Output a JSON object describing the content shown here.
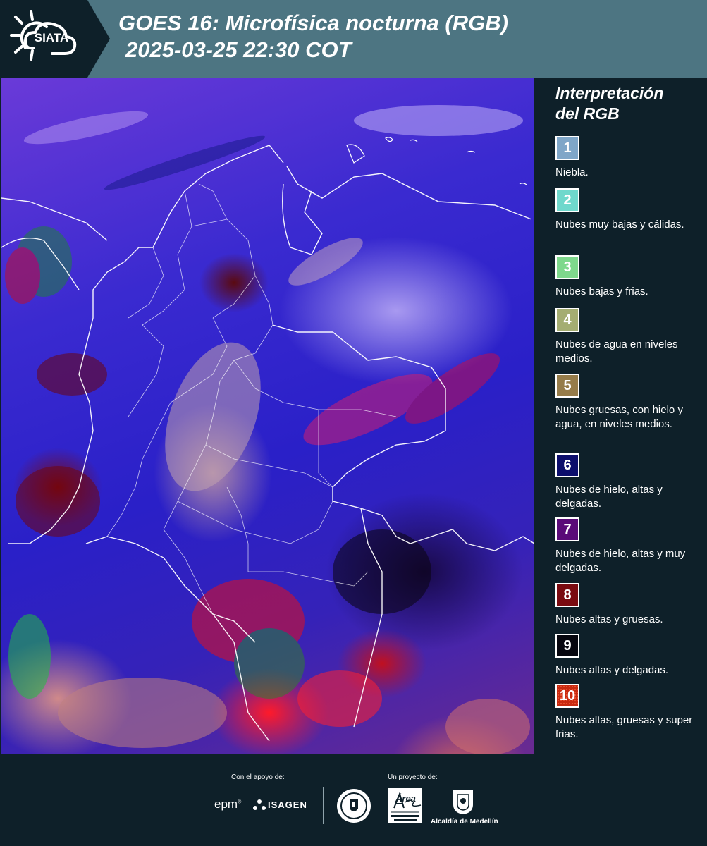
{
  "header": {
    "logo_text": "SIATA",
    "title": "GOES 16: Microfísica nocturna (RGB)",
    "datetime": "2025-03-25 22:30 COT"
  },
  "legend": {
    "title_line1": "Interpretación",
    "title_line2": "del RGB",
    "items": [
      {
        "num": "1",
        "label": "Niebla.",
        "color": "#7fa6c8"
      },
      {
        "num": "2",
        "label": "Nubes muy bajas y cálidas.",
        "color": "#6fd8cc"
      },
      {
        "num": "3",
        "label": "Nubes bajas y frias.",
        "color": "#7ed88c"
      },
      {
        "num": "4",
        "label": "Nubes de agua en niveles medios.",
        "color": "#a4ad72"
      },
      {
        "num": "5",
        "label": "Nubes gruesas, con hielo y agua, en niveles medios.",
        "color": "#967c4a"
      },
      {
        "num": "6",
        "label": "Nubes de hielo, altas y delgadas.",
        "color": "#0c0e6c"
      },
      {
        "num": "7",
        "label": "Nubes de hielo, altas y muy delgadas.",
        "color": "#5a0a78"
      },
      {
        "num": "8",
        "label": "Nubes altas y gruesas.",
        "color": "#7a0a10"
      },
      {
        "num": "9",
        "label": "Nubes altas y delgadas.",
        "color": "#06060e"
      },
      {
        "num": "10",
        "label": "Nubes altas, gruesas y super frias.",
        "color": "#c82a10"
      }
    ]
  },
  "footer": {
    "support_label": "Con el apoyo de:",
    "project_label": "Un proyecto de:",
    "epm": "epm",
    "isagen": "ISAGEN",
    "area_text": "Área",
    "metropolitana": "METROPOLITANA",
    "valle": "Valle de Aburrá",
    "alcaldia": "Alcaldía de Medellín"
  }
}
